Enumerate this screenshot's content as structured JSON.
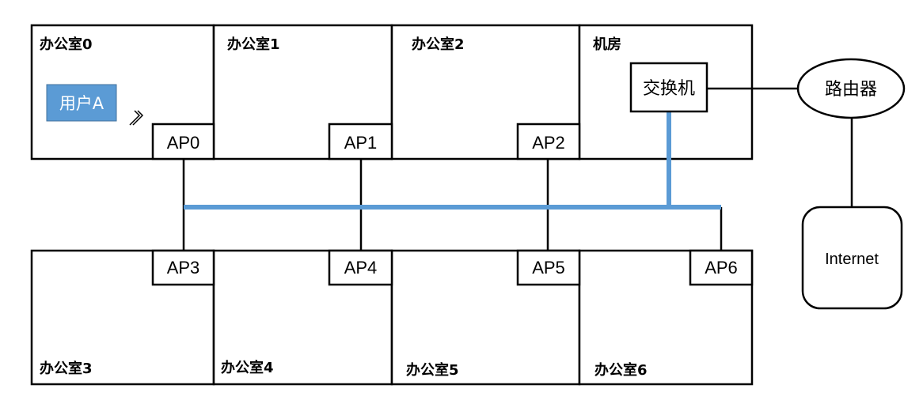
{
  "colors": {
    "backbone": "#5b9bd5",
    "user_fill": "#5b9bd5",
    "user_text": "#ffffff",
    "line": "#000000"
  },
  "rooms": {
    "r0": "办公室0",
    "r1": "办公室1",
    "r2": "办公室2",
    "server_room": "机房",
    "r3": "办公室3",
    "r4": "办公室4",
    "r5": "办公室5",
    "r6": "办公室6"
  },
  "aps": {
    "ap0": "AP0",
    "ap1": "AP1",
    "ap2": "AP2",
    "ap3": "AP3",
    "ap4": "AP4",
    "ap5": "AP5",
    "ap6": "AP6"
  },
  "switch": "交换机",
  "router": "路由器",
  "internet": "Internet",
  "user": "用户A",
  "signal_icon": "wireless-signal-icon"
}
